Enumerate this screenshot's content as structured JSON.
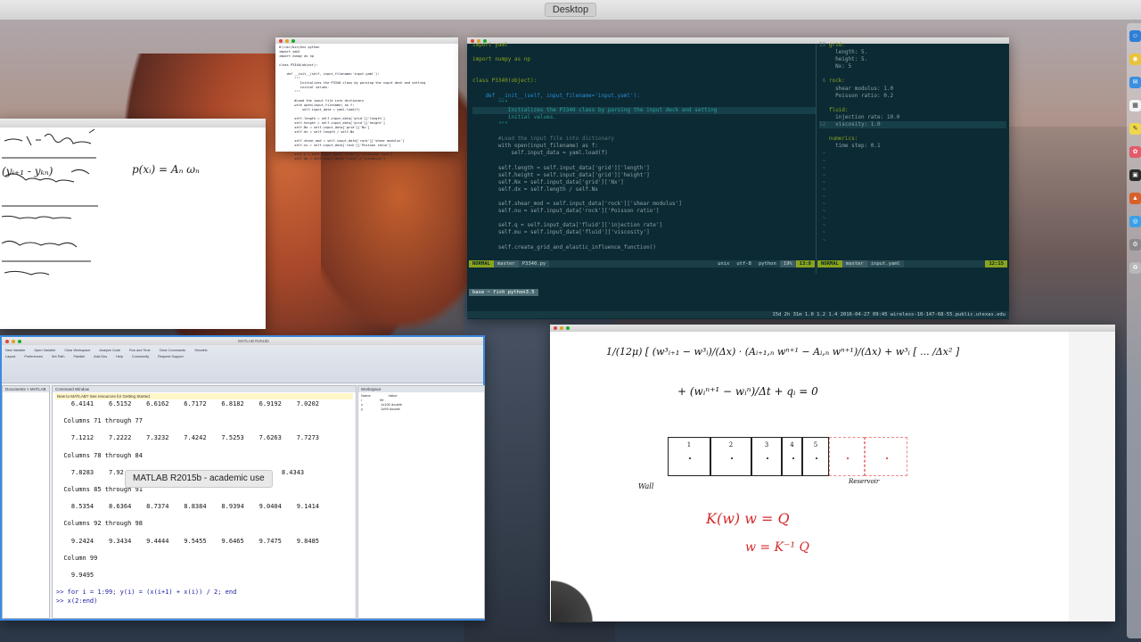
{
  "menubar": {
    "title": "Desktop"
  },
  "notes_window": {
    "lines": [
      "(yᵢ₊₁ - yₖₙ)",
      "p(xᵢ) = Aₙ ωₙ"
    ]
  },
  "python_preview": {
    "lines": [
      "#!/usr/bin/env python",
      "import yaml",
      "import numpy as np",
      "",
      "class P3340(object):",
      "",
      "    def __init__(self, input_filename='input.yaml'):",
      "        \"\"\"",
      "           Initializes the P3340 class by parsing the input deck and setting",
      "           initial values.",
      "        \"\"\"",
      "",
      "        #Load the input file into dictionary",
      "        with open(input_filename) as f:",
      "            self.input_data = yaml.load(f)",
      "",
      "        self.length = self.input_data['grid']['length']",
      "        self.height = self.input_data['grid']['height']",
      "        self.Nx = self.input_data['grid']['Nx']",
      "        self.dx = self.length / self.Nx",
      "",
      "        self.shear_mod = self.input_data['rock']['shear modulus']",
      "        self.nu = self.input_data['rock']['Poisson ratio']",
      "",
      "        self.q = self.input_data['fluid']['injection rate']",
      "        self.mu = self.input_data['fluid']['viscosity']"
    ]
  },
  "terminal": {
    "left_code": [
      {
        "t": "import yaml",
        "c": "kw"
      },
      {
        "t": "",
        "c": ""
      },
      {
        "t": "import numpy as np",
        "c": "kw"
      },
      {
        "t": "",
        "c": ""
      },
      {
        "t": "",
        "c": ""
      },
      {
        "t": "class P3340(object):",
        "c": "kw"
      },
      {
        "t": "",
        "c": ""
      },
      {
        "t": "    def __init__(self, input_filename='input.yaml'):",
        "c": "fn"
      },
      {
        "t": "        \"\"\"",
        "c": "st"
      },
      {
        "t": "           Initializes the P3340 class by parsing the input deck and setting",
        "c": "st"
      },
      {
        "t": "           initial values.",
        "c": "st"
      },
      {
        "t": "        \"\"\"",
        "c": "st"
      },
      {
        "t": "",
        "c": ""
      },
      {
        "t": "        #Load the input file into dictionary",
        "c": "cm"
      },
      {
        "t": "        with open(input_filename) as f:",
        "c": ""
      },
      {
        "t": "            self.input_data = yaml.load(f)",
        "c": ""
      },
      {
        "t": "",
        "c": ""
      },
      {
        "t": "        self.length = self.input_data['grid']['length']",
        "c": ""
      },
      {
        "t": "        self.height = self.input_data['grid']['height']",
        "c": ""
      },
      {
        "t": "        self.Nx = self.input_data['grid']['Nx']",
        "c": ""
      },
      {
        "t": "        self.dx = self.length / self.Nx",
        "c": ""
      },
      {
        "t": "",
        "c": ""
      },
      {
        "t": "        self.shear_mod = self.input_data['rock']['shear modulus']",
        "c": ""
      },
      {
        "t": "        self.nu = self.input_data['rock']['Poisson ratio']",
        "c": ""
      },
      {
        "t": "",
        "c": ""
      },
      {
        "t": "        self.q = self.input_data['fluid']['injection rate']",
        "c": ""
      },
      {
        "t": "        self.mu = self.input_data['fluid']['viscosity']",
        "c": ""
      },
      {
        "t": "",
        "c": ""
      },
      {
        "t": "        self.create_grid_and_elastic_influence_function()",
        "c": ""
      }
    ],
    "right_code": [
      {
        "n": "13",
        "t": "grid:",
        "c": "kw"
      },
      {
        "n": "",
        "t": "  length: 5.",
        "c": ""
      },
      {
        "n": "",
        "t": "  height: 5.",
        "c": ""
      },
      {
        "n": "",
        "t": "  Nx: 5",
        "c": ""
      },
      {
        "n": "",
        "t": "",
        "c": ""
      },
      {
        "n": "6",
        "t": "rock:",
        "c": "kw"
      },
      {
        "n": "",
        "t": "  shear modulus: 1.0",
        "c": ""
      },
      {
        "n": "",
        "t": "  Poisson ratio: 0.2",
        "c": ""
      },
      {
        "n": "",
        "t": "",
        "c": ""
      },
      {
        "n": "",
        "t": "fluid:",
        "c": "kw"
      },
      {
        "n": "",
        "t": "  injection rate: 10.0",
        "c": ""
      },
      {
        "n": "12",
        "t": "  viscosity: 1.0",
        "c": ""
      },
      {
        "n": "",
        "t": "",
        "c": ""
      },
      {
        "n": "",
        "t": "numerics:",
        "c": "kw"
      },
      {
        "n": "",
        "t": "  time step: 0.1",
        "c": ""
      }
    ],
    "left_status": {
      "mode": "NORMAL",
      "branch": "master",
      "file": "P3340.py",
      "enc": "unix",
      "charset": "utf-8",
      "ft": "python",
      "pct": "19%",
      "pos": "13:8"
    },
    "right_status": {
      "mode": "NORMAL",
      "branch": "master",
      "file": "input.yaml",
      "pos": "12:15"
    },
    "prompt_line": "base  ~  fish    python3.5",
    "tmux_line": "15d 2h 31m  1.0 1.2 1.4  2016-04-27  09:45  wireless-10-147-68-55.public.utexas.edu"
  },
  "matlab": {
    "title": "MATLAB R2015b",
    "panes": {
      "documents": "Documents > MATLAB",
      "command": "Command Window",
      "workspace": "Workspace"
    },
    "notice": "New to MATLAB? See resources for Getting Started.",
    "ws_header": [
      "Name",
      "Value"
    ],
    "ws_rows": [
      [
        "i",
        "99"
      ],
      [
        "x",
        "1x100 double"
      ],
      [
        "y",
        "1x99 double"
      ]
    ],
    "rows": [
      {
        "t": "    6.4141    6.5152    6.6162    6.7172    6.8182    6.9192    7.0202"
      },
      {
        "t": ""
      },
      {
        "t": "  Columns 71 through 77"
      },
      {
        "t": ""
      },
      {
        "t": "    7.1212    7.2222    7.3232    7.4242    7.5253    7.6263    7.7273"
      },
      {
        "t": ""
      },
      {
        "t": "  Columns 78 through 84"
      },
      {
        "t": ""
      },
      {
        "t": "    7.8283    7.92                                  3333    8.4343"
      },
      {
        "t": ""
      },
      {
        "t": "  Columns 85 through 91"
      },
      {
        "t": ""
      },
      {
        "t": "    8.5354    8.6364    8.7374    8.8384    8.9394    9.0404    9.1414"
      },
      {
        "t": ""
      },
      {
        "t": "  Columns 92 through 98"
      },
      {
        "t": ""
      },
      {
        "t": "    9.2424    9.3434    9.4444    9.5455    9.6465    9.7475    9.8485"
      },
      {
        "t": ""
      },
      {
        "t": "  Column 99"
      },
      {
        "t": ""
      },
      {
        "t": "    9.9495"
      },
      {
        "t": ""
      },
      {
        "t": ">> for i = 1:99; y(i) = (x(i+1) + x(i)) / 2; end"
      },
      {
        "t": ">> x(2:end)"
      }
    ],
    "tooltip": "MATLAB R2015b - academic use",
    "ribbon_labels": [
      "New Variable",
      "Open Variable",
      "Clear Workspace",
      "Analyze Code",
      "Run and Time",
      "Clear Commands",
      "Simulink",
      "Layout",
      "Preferences",
      "Set Path",
      "Parallel",
      "Add-Ons",
      "Help",
      "Community",
      "Request Support"
    ]
  },
  "whiteboard": {
    "eq1": "1/(12μ) [ (w³ᵢ₊₁ − w³ᵢ)/(Δx)  ·  (Aᵢ₊₁,ₙ wⁿ⁺¹ − Aᵢ,ₙ wⁿ⁺¹)/(Δx)  +  w³ᵢ [ ... /Δx² ]",
    "eq2": "+ (wᵢⁿ⁺¹ − wᵢⁿ)/Δt + qᵢ = 0",
    "cells": [
      "1",
      "2",
      "3",
      "4",
      "5"
    ],
    "wall_label": "Wall",
    "reservoir_label": "Reservoir",
    "eq3": "K(w) w = Q",
    "eq4": "w = K⁻¹ Q",
    "ink_color": "#d42a2a"
  },
  "dock": {
    "icons": [
      "finder-icon",
      "chrome-icon",
      "mail-icon",
      "calendar-icon",
      "notes-icon",
      "photos-icon",
      "terminal-icon",
      "matlab-icon",
      "safari-icon",
      "settings-icon",
      "trash-icon"
    ]
  }
}
